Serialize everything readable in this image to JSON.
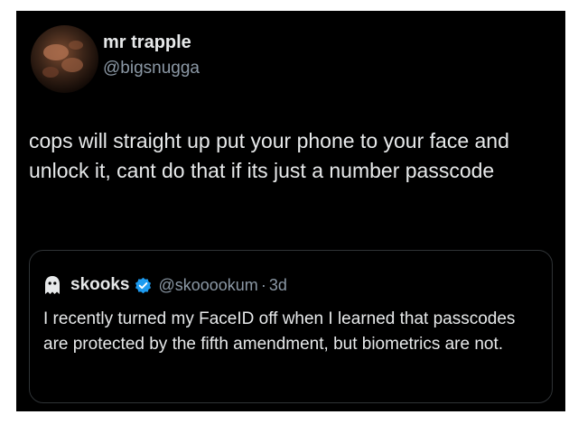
{
  "author": {
    "name": "mr trapple",
    "handle": "@bigsnugga"
  },
  "tweet": {
    "text": "cops will straight up put your phone to your face and unlock it, cant do that if its just a number passcode"
  },
  "quoted_tweet": {
    "icon": "ghost-icon",
    "name": "skooks",
    "verified": true,
    "handle": "@skooookum",
    "separator": "·",
    "time": "3d",
    "text": "I recently turned my FaceID off when I learned that passcodes are protected by the fifth amendment, but biometrics are not."
  },
  "colors": {
    "background": "#000000",
    "primary_text": "#e7e9ea",
    "secondary_text": "#8b98a5",
    "verified_badge": "#1d9bf0",
    "quote_border": "#2f3336"
  }
}
